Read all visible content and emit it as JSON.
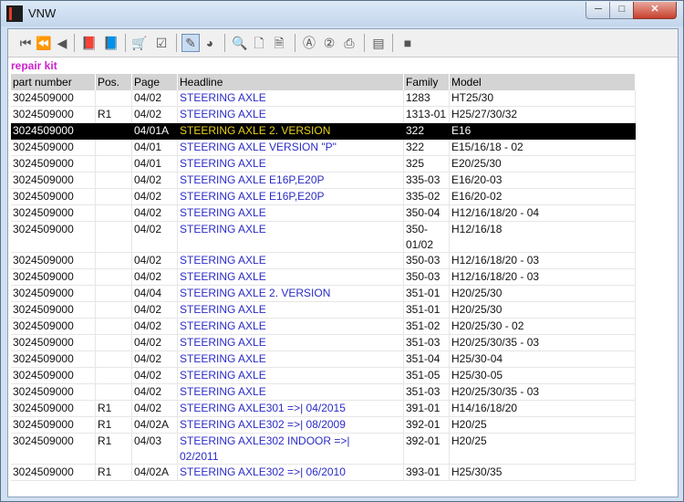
{
  "window": {
    "title": "VNW",
    "min_label": "─",
    "max_label": "□",
    "close_label": "✕"
  },
  "toolbar": {
    "icons": [
      {
        "name": "first-record-icon",
        "glyph": "⏮"
      },
      {
        "name": "previous-page-icon",
        "glyph": "⏪"
      },
      {
        "name": "previous-record-icon",
        "glyph": "◀"
      },
      {
        "name": "book-back-icon",
        "glyph": "📕"
      },
      {
        "name": "book-forward-icon",
        "glyph": "📘"
      },
      {
        "name": "cart-icon",
        "glyph": "🛒"
      },
      {
        "name": "checklist-icon",
        "glyph": "☑"
      },
      {
        "name": "pencil-tool-icon",
        "glyph": "✎"
      },
      {
        "name": "globe-icon",
        "glyph": "◕"
      },
      {
        "name": "zoom-icon",
        "glyph": "🔍"
      },
      {
        "name": "page-icon",
        "glyph": "🗋"
      },
      {
        "name": "page-pointer-icon",
        "glyph": "🗎"
      },
      {
        "name": "circle-a-icon",
        "glyph": "Ⓐ"
      },
      {
        "name": "circle-2-icon",
        "glyph": "②"
      },
      {
        "name": "print-icon",
        "glyph": "⎙"
      },
      {
        "name": "notes-icon",
        "glyph": "▤"
      },
      {
        "name": "stop-icon",
        "glyph": "■"
      }
    ]
  },
  "section_title": "repair kit",
  "table": {
    "headers": [
      "part number",
      "Pos.",
      "Page",
      "Headline",
      "Family",
      "Model"
    ],
    "selected_index": 2,
    "rows": [
      [
        "3024509000",
        "",
        "04/02",
        "STEERING AXLE",
        "1283",
        "HT25/30"
      ],
      [
        "3024509000",
        "R1",
        "04/02",
        "STEERING AXLE",
        "1313-01",
        "H25/27/30/32"
      ],
      [
        "3024509000",
        "",
        "04/01A",
        "STEERING AXLE 2. VERSION",
        "322",
        "E16"
      ],
      [
        "3024509000",
        "",
        "04/01",
        "STEERING AXLE VERSION \"P\"",
        "322",
        "E15/16/18 - 02"
      ],
      [
        "3024509000",
        "",
        "04/01",
        "STEERING AXLE",
        "325",
        "E20/25/30"
      ],
      [
        "3024509000",
        "",
        "04/02",
        "STEERING AXLE E16P,E20P",
        "335-03",
        "E16/20-03"
      ],
      [
        "3024509000",
        "",
        "04/02",
        "STEERING AXLE E16P,E20P",
        "335-02",
        "E16/20-02"
      ],
      [
        "3024509000",
        "",
        "04/02",
        "STEERING AXLE",
        "350-04",
        "H12/16/18/20 - 04"
      ],
      [
        "3024509000",
        "",
        "04/02",
        "STEERING AXLE",
        "350-\n01/02",
        "H12/16/18"
      ],
      [
        "3024509000",
        "",
        "04/02",
        "STEERING AXLE",
        "350-03",
        "H12/16/18/20 - 03"
      ],
      [
        "3024509000",
        "",
        "04/02",
        "STEERING AXLE",
        "350-03",
        "H12/16/18/20 - 03"
      ],
      [
        "3024509000",
        "",
        "04/04",
        "STEERING AXLE 2. VERSION",
        "351-01",
        "H20/25/30"
      ],
      [
        "3024509000",
        "",
        "04/02",
        "STEERING AXLE",
        "351-01",
        "H20/25/30"
      ],
      [
        "3024509000",
        "",
        "04/02",
        "STEERING AXLE",
        "351-02",
        "H20/25/30 - 02"
      ],
      [
        "3024509000",
        "",
        "04/02",
        "STEERING AXLE",
        "351-03",
        "H20/25/30/35 - 03"
      ],
      [
        "3024509000",
        "",
        "04/02",
        "STEERING AXLE",
        "351-04",
        "H25/30-04"
      ],
      [
        "3024509000",
        "",
        "04/02",
        "STEERING AXLE",
        "351-05",
        "H25/30-05"
      ],
      [
        "3024509000",
        "",
        "04/02",
        "STEERING AXLE",
        "351-03",
        "H20/25/30/35 - 03"
      ],
      [
        "3024509000",
        "R1",
        "04/02",
        "STEERING AXLE301 =>| 04/2015",
        "391-01",
        "H14/16/18/20"
      ],
      [
        "3024509000",
        "R1",
        "04/02A",
        "STEERING AXLE302 =>| 08/2009",
        "392-01",
        "H20/25"
      ],
      [
        "3024509000",
        "R1",
        "04/03",
        "STEERING AXLE302 INDOOR =>|\n02/2011",
        "392-01",
        "H20/25"
      ],
      [
        "3024509000",
        "R1",
        "04/02A",
        "STEERING AXLE302 =>| 06/2010",
        "393-01",
        "H25/30/35"
      ]
    ]
  }
}
